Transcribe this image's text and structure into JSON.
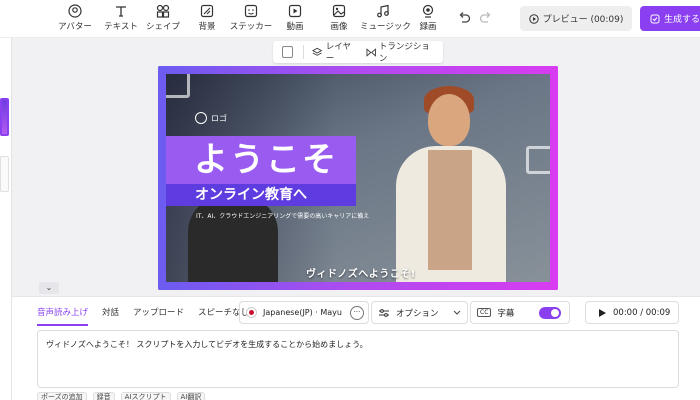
{
  "toolbar": {
    "tools": [
      {
        "label": "アバター",
        "icon": "avatar-icon"
      },
      {
        "label": "テキスト",
        "icon": "text-icon"
      },
      {
        "label": "シェイプ",
        "icon": "shape-icon"
      },
      {
        "label": "背景",
        "icon": "background-icon"
      },
      {
        "label": "ステッカー",
        "icon": "sticker-icon"
      },
      {
        "label": "動画",
        "icon": "video-icon"
      },
      {
        "label": "画像",
        "icon": "image-icon"
      },
      {
        "label": "ミュージック",
        "icon": "music-icon"
      },
      {
        "label": "録画",
        "icon": "record-icon"
      }
    ],
    "preview_label": "プレビュー (00:09)",
    "generate_label": "生成する"
  },
  "layer_bar": {
    "layer_label": "レイヤー",
    "transition_label": "トランジション"
  },
  "video": {
    "logo_label": "ロゴ",
    "title": "ようこそ",
    "subtitle": "オンライン教育へ",
    "description": "IT、AI、クラウドエンジニアリングで需要の高いキャリアに備え",
    "caption": "ヴィドノズへようこそ!"
  },
  "panel": {
    "tabs": [
      "音声読み上げ",
      "対話",
      "アップロード",
      "スピーチなし"
    ],
    "voice": "Japanese(JP) · Mayu",
    "option_label": "オプション",
    "subtitle_label": "字幕",
    "cc_label": "CC",
    "time": "00:00 / 00:09",
    "script": "ヴィドノズへようこそ！ スクリプトを入力してビデオを生成することから始めましょう。",
    "chips": [
      "ポーズの追加",
      "録音",
      "AIスクリプト",
      "AI翻訳"
    ]
  },
  "colors": {
    "accent": "#8a3ff0",
    "video_border": "#6b5cf0"
  }
}
